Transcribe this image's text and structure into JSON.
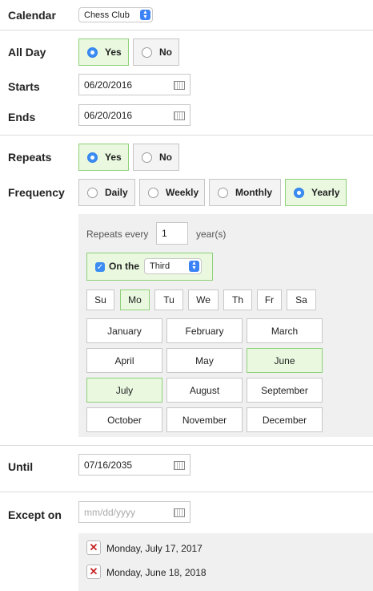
{
  "calendar": {
    "label": "Calendar",
    "value": "Chess Club"
  },
  "all_day": {
    "label": "All Day",
    "yes": "Yes",
    "no": "No",
    "selected": "yes"
  },
  "starts": {
    "label": "Starts",
    "value": "06/20/2016"
  },
  "ends": {
    "label": "Ends",
    "value": "06/20/2016"
  },
  "repeats": {
    "label": "Repeats",
    "yes": "Yes",
    "no": "No",
    "selected": "yes"
  },
  "frequency": {
    "label": "Frequency",
    "options": [
      "Daily",
      "Weekly",
      "Monthly",
      "Yearly"
    ],
    "selected": "Yearly"
  },
  "repeat_panel": {
    "every_prefix": "Repeats every",
    "every_value": "1",
    "every_suffix": "year(s)",
    "on_the_label": "On the",
    "on_the_value": "Third",
    "days": [
      "Su",
      "Mo",
      "Tu",
      "We",
      "Th",
      "Fr",
      "Sa"
    ],
    "selected_day": "Mo",
    "months": [
      "January",
      "February",
      "March",
      "April",
      "May",
      "June",
      "July",
      "August",
      "September",
      "October",
      "November",
      "December"
    ],
    "selected_months": [
      "June",
      "July"
    ]
  },
  "until": {
    "label": "Until",
    "value": "07/16/2035"
  },
  "except_on": {
    "label": "Except on",
    "placeholder": "mm/dd/yyyy",
    "dates": [
      "Monday, July 17, 2017",
      "Monday, June 18, 2018"
    ]
  },
  "colors": {
    "selected_bg": "#e9f8df",
    "selected_border": "#8fd17a",
    "accent": "#3b8df4",
    "remove": "#c62828"
  }
}
